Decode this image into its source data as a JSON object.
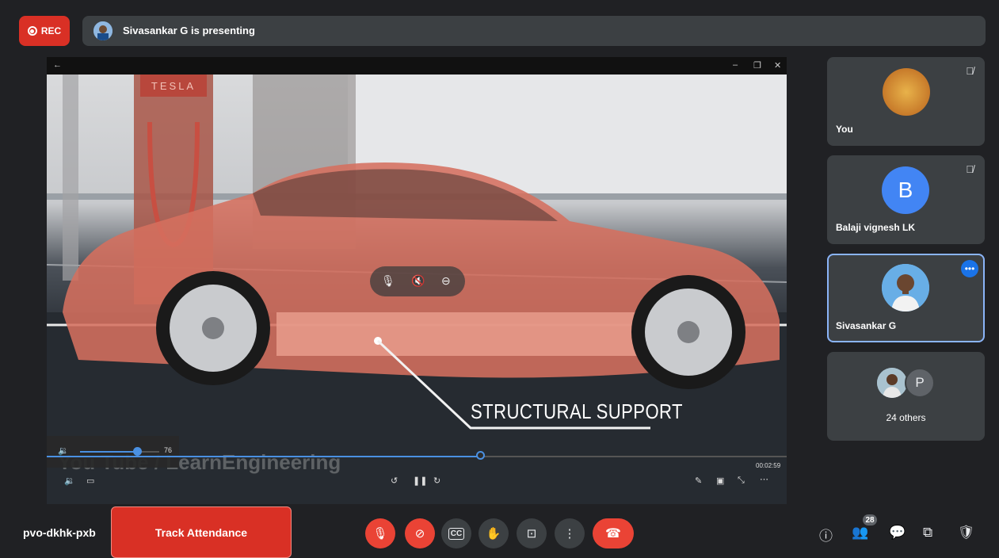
{
  "header": {
    "rec_label": "REC",
    "presenting_text": "Sivasankar G is presenting"
  },
  "screen": {
    "window_back": "←",
    "window_controls": [
      "–",
      "❐",
      "✕"
    ],
    "overlay_text": "STRUCTURAL SUPPORT",
    "watermark": "You Tube / LearnEngineering",
    "volume_value": "76",
    "volume_fraction": 0.76,
    "progress_fraction": 0.59,
    "time_label": "00:02:59",
    "brand_sign": "TESLA"
  },
  "participants": [
    {
      "name": "You",
      "muted": true
    },
    {
      "name": "Balaji vignesh LK",
      "initial": "B",
      "avatar_color": "#4285f4",
      "muted": true
    },
    {
      "name": "Sivasankar G",
      "active": true
    },
    {
      "name": "24 others",
      "initial": "P",
      "initial_color": "#8ab4f8"
    }
  ],
  "footer": {
    "meeting_code": "pvo-dkhk-pxb",
    "track_attendance": "Track Attendance",
    "participants_badge": "28"
  },
  "colors": {
    "accent": "#1a73e8",
    "danger": "#ea4335",
    "tile_bg": "#3c4043",
    "page_bg": "#202124"
  }
}
